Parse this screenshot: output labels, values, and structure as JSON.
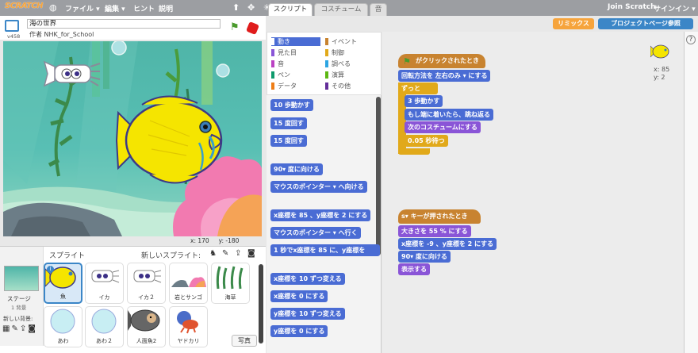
{
  "topbar": {
    "logo": "SCRATCH",
    "menu_file": "ファイル ▾",
    "menu_edit": "編集 ▾",
    "menu_hint": "ヒント",
    "menu_about": "説明",
    "join": "Join Scratch",
    "signin": "サインイン ▾"
  },
  "project": {
    "title": "海の世界",
    "author": "作者 NHK_for_School",
    "version": "v458"
  },
  "stage": {
    "coords_x": "x: 170",
    "coords_y": "y: -180"
  },
  "sprite_pane": {
    "header": "スプライト",
    "new_sprite": "新しいスプライト:",
    "stage_label": "ステージ",
    "stage_sub": "1 背景",
    "new_backdrop": "新しい背景:",
    "photo": "写真",
    "sprites": [
      {
        "name": "魚",
        "selected": true
      },
      {
        "name": "イカ"
      },
      {
        "name": "イカ２"
      },
      {
        "name": "岩とサンゴ"
      },
      {
        "name": "海草"
      },
      {
        "name": "あわ"
      },
      {
        "name": "あわ２"
      },
      {
        "name": "人面魚2"
      },
      {
        "name": "ヤドカリ"
      }
    ]
  },
  "tabs": [
    "スクリプト",
    "コスチューム",
    "音"
  ],
  "categories": [
    {
      "label": "動き",
      "color": "#4a6cd4"
    },
    {
      "label": "イベント",
      "color": "#c88330"
    },
    {
      "label": "見た目",
      "color": "#8a55d7"
    },
    {
      "label": "制御",
      "color": "#e1a91a"
    },
    {
      "label": "音",
      "color": "#bb42c3"
    },
    {
      "label": "調べる",
      "color": "#2ca5e2"
    },
    {
      "label": "ペン",
      "color": "#0e9a6c"
    },
    {
      "label": "演算",
      "color": "#5cb712"
    },
    {
      "label": "データ",
      "color": "#ee7d16"
    },
    {
      "label": "その他",
      "color": "#632d99"
    }
  ],
  "palette": {
    "move": "10 歩動かす",
    "turn_r": "15 度回す",
    "turn_l": "15 度回す",
    "point_dir": "90▾ 度に向ける",
    "point_toward": "マウスのポインター ▾ へ向ける",
    "goto_xy": "x座標を 85 、y座標を 2 にする",
    "goto": "マウスのポインター ▾ へ行く",
    "glide": "1 秒でx座標を 85 に、y座標を",
    "change_x": "x座標を 10 ずつ変える",
    "set_x": "x座標を 0 にする",
    "change_y": "y座標を 10 ずつ変える",
    "set_y": "y座標を 0 にする"
  },
  "header_buttons": {
    "remix": "リミックス",
    "project_page": "プロジェクトページ参照"
  },
  "sprite_info": {
    "x": "x: 85",
    "y": "y: 2"
  },
  "script1": {
    "hat": "がクリックされたとき",
    "rot": "回転方法を 左右のみ ▾ にする",
    "forever": "ずっと",
    "move": "3 歩動かす",
    "bounce": "もし端に着いたら、跳ね返る",
    "next": "次のコスチュームにする",
    "wait": "0.05 秒待つ"
  },
  "script2": {
    "hat": "s▾ キーが押されたとき",
    "size": "大きさを 55 % にする",
    "goto": "x座標を -9 、y座標を 2 にする",
    "dir": "90▾ 度に向ける",
    "show": "表示する"
  }
}
